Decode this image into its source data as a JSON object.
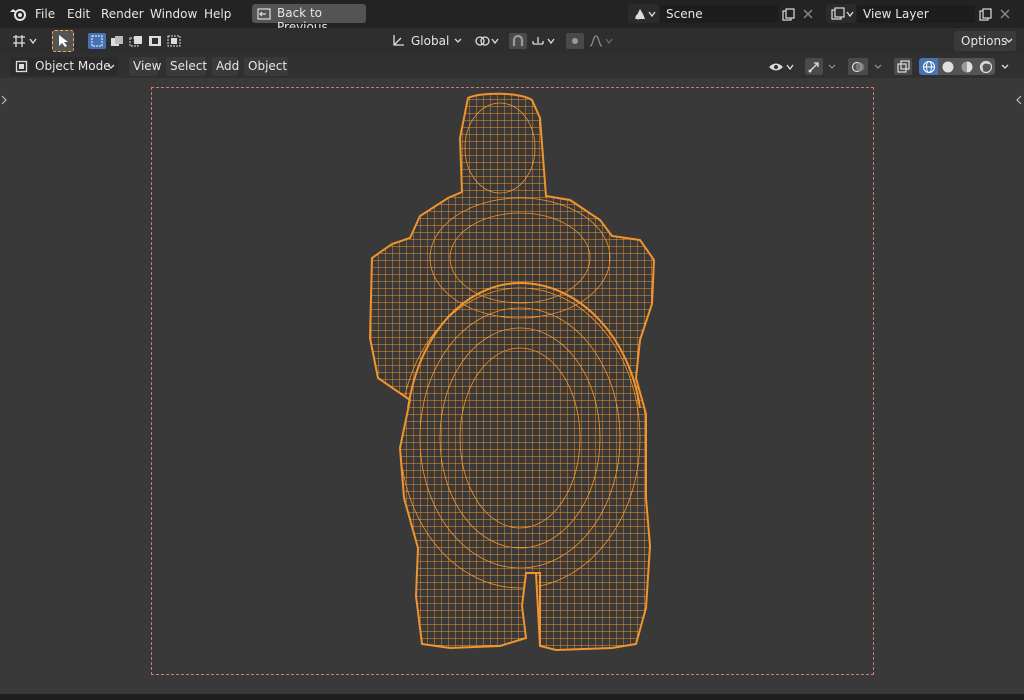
{
  "menu": {
    "file": "File",
    "edit": "Edit",
    "render": "Render",
    "window": "Window",
    "help": "Help",
    "back": "Back to Previous"
  },
  "scene": {
    "value": "Scene"
  },
  "view_layer": {
    "value": "View Layer"
  },
  "toolbar": {
    "orientation": "Global",
    "options": "Options"
  },
  "header": {
    "mode": "Object Mode",
    "view": "View",
    "select": "Select",
    "add": "Add",
    "object": "Object"
  },
  "colors": {
    "wire": "#f0942f",
    "accent_blue": "#4772b3",
    "select_orange": "#ffaa40",
    "camera_frame": "#d8786a"
  },
  "icons": [
    "blender-logo",
    "back-icon",
    "scene-icon",
    "copy-icon",
    "close-icon",
    "view-layer-icon",
    "editor-type-icon",
    "select-tool-icon",
    "select-mode-icons",
    "transform-orientation-icon",
    "pivot-icon",
    "snap-icon",
    "proportional-icon",
    "object-mode-icon",
    "visibility-icon",
    "gizmo-icon",
    "overlay-icon",
    "xray-icon",
    "wireframe-shading-icon",
    "solid-shading-icon",
    "material-shading-icon",
    "rendered-shading-icon"
  ]
}
